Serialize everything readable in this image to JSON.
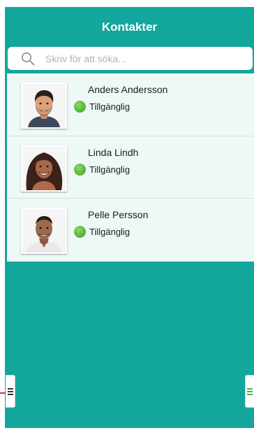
{
  "header": {
    "title": "Kontakter"
  },
  "search": {
    "placeholder": "Skriv för att söka...",
    "icon": "search-icon"
  },
  "contacts": [
    {
      "name": "Anders Andersson",
      "status": "Tillgänglig",
      "status_color": "#5cb93b",
      "avatar": "avatar-photo-man-smiling"
    },
    {
      "name": "Linda Lindh",
      "status": "Tillgänglig",
      "status_color": "#5cb93b",
      "avatar": "avatar-photo-woman-smiling"
    },
    {
      "name": "Pelle Persson",
      "status": "Tillgänglig",
      "status_color": "#5cb93b",
      "avatar": "avatar-photo-man-shirt"
    }
  ],
  "side_handles": {
    "left": "menu-handle-icon",
    "right": "menu-handle-icon"
  },
  "colors": {
    "background": "#12a69c",
    "list_bg": "#eef8f7",
    "status_online": "#5cb93b",
    "edge_accent": "#e0263c",
    "right_handle_lines": "#44b649"
  }
}
